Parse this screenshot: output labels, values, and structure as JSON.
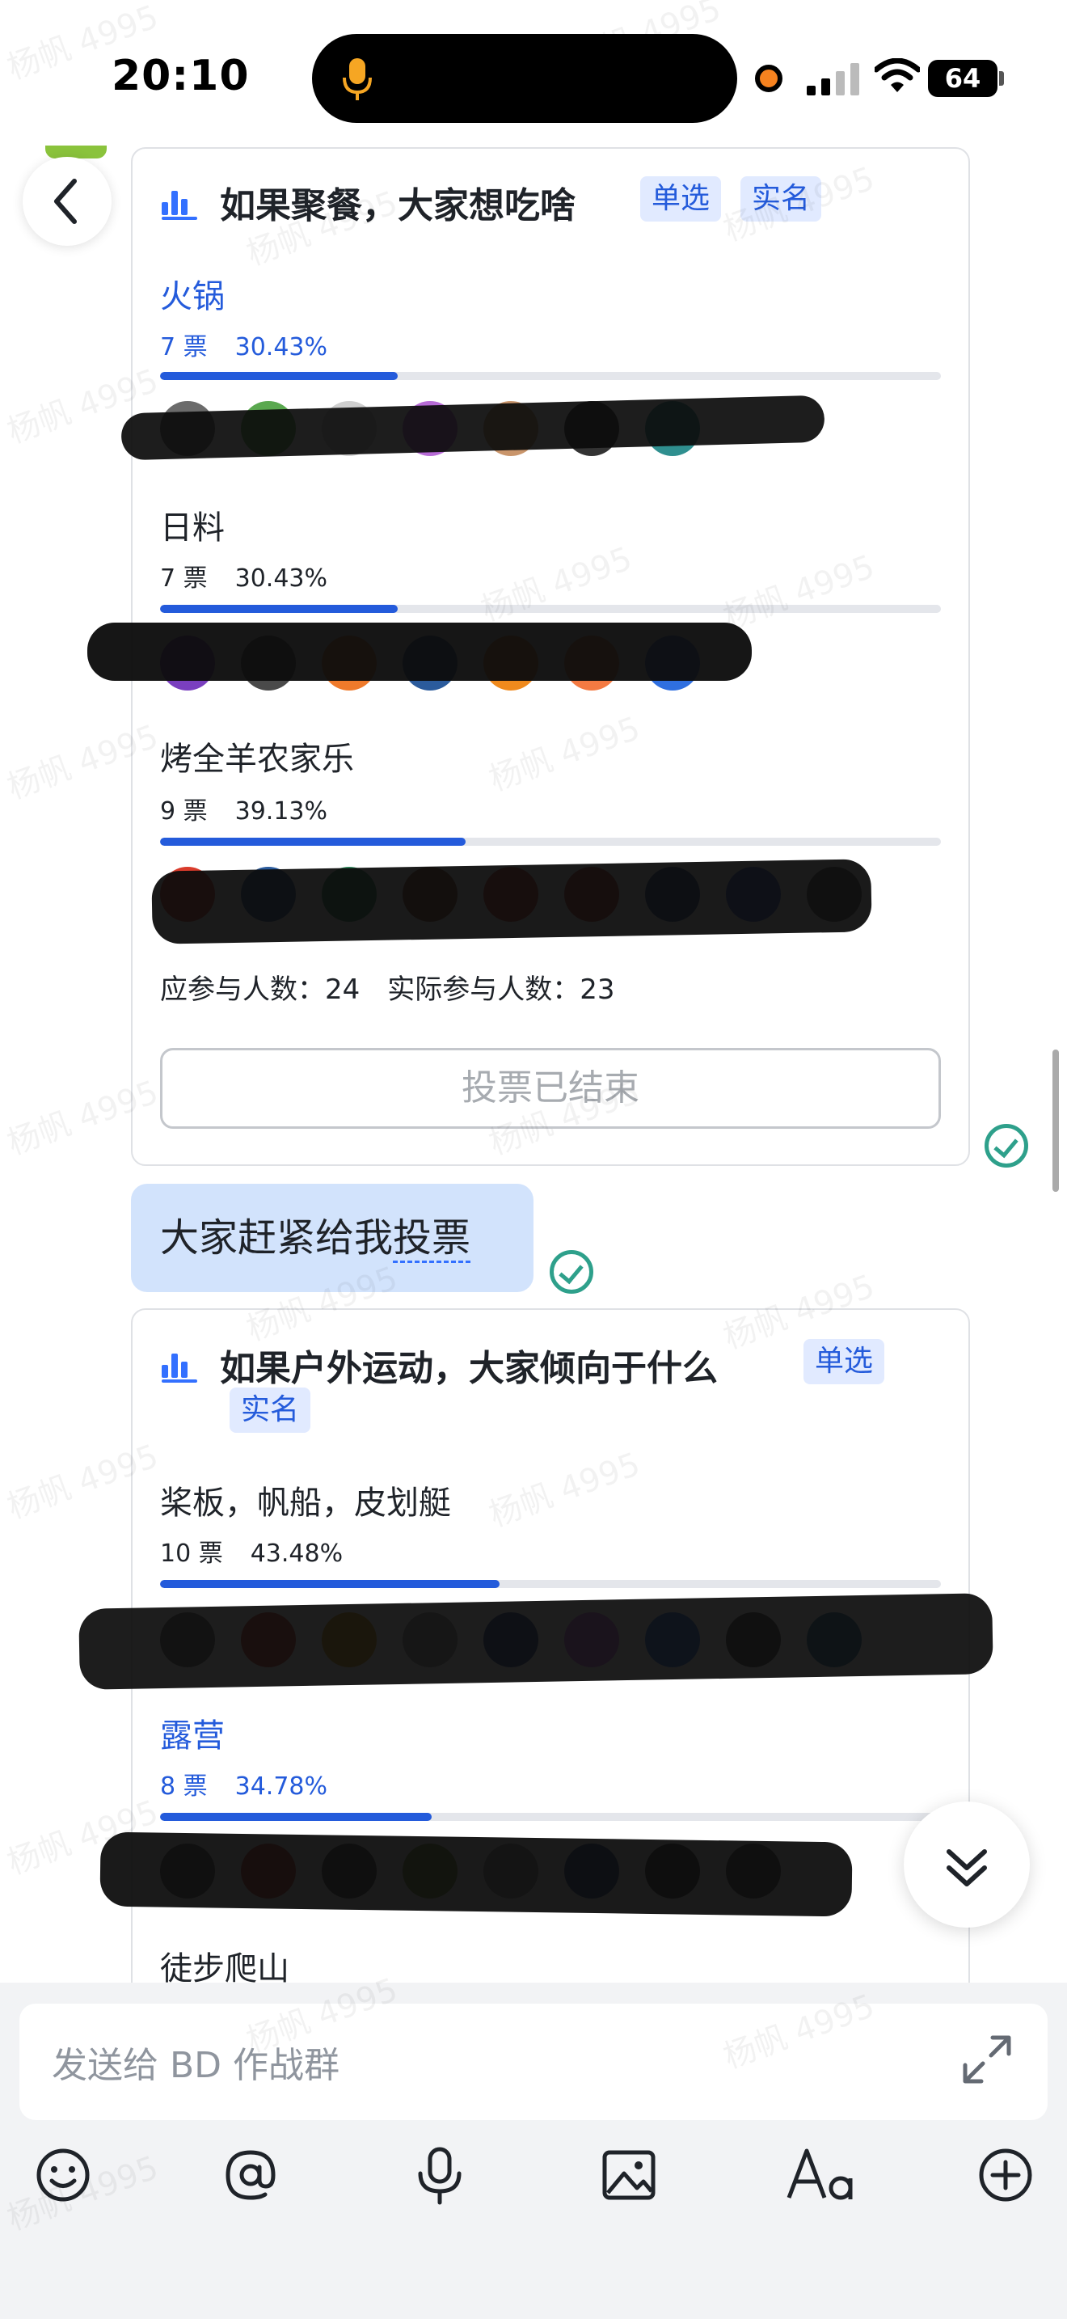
{
  "status_bar": {
    "time": "20:10",
    "battery": "64"
  },
  "watermark": "杨帆 4995",
  "poll1": {
    "title": "如果聚餐，大家想吃啥",
    "tags": [
      "单选",
      "实名"
    ],
    "options": [
      {
        "label": "火锅",
        "votes": "7 票",
        "percent": "30.43%",
        "fraction": 0.3043,
        "selected": true
      },
      {
        "label": "日料",
        "votes": "7 票",
        "percent": "30.43%",
        "fraction": 0.3043,
        "selected": false
      },
      {
        "label": "烤全羊农家乐",
        "votes": "9 票",
        "percent": "39.13%",
        "fraction": 0.3913,
        "selected": false
      }
    ],
    "expected_label": "应参与人数：24",
    "actual_label": "实际参与人数：23",
    "ended_button": "投票已结束"
  },
  "message": {
    "text_plain": "大家赶紧给我",
    "text_underlined": "投票"
  },
  "poll2": {
    "title": "如果户外运动，大家倾向于什么",
    "tags": [
      "单选",
      "实名"
    ],
    "options": [
      {
        "label": "桨板，帆船，皮划艇",
        "votes": "10 票",
        "percent": "43.48%",
        "fraction": 0.4348,
        "selected": false
      },
      {
        "label": "露营",
        "votes": "8 票",
        "percent": "34.78%",
        "fraction": 0.3478,
        "selected": true
      },
      {
        "label": "徒步爬山"
      }
    ]
  },
  "composer": {
    "placeholder": "发送给 BD 作战群",
    "tools": [
      "emoji-icon",
      "mention-icon",
      "voice-icon",
      "image-icon",
      "text-format-icon",
      "add-icon"
    ]
  },
  "colors": {
    "accent": "#245bdb",
    "bubble": "#d2e3fc",
    "check": "#2ea08b"
  }
}
